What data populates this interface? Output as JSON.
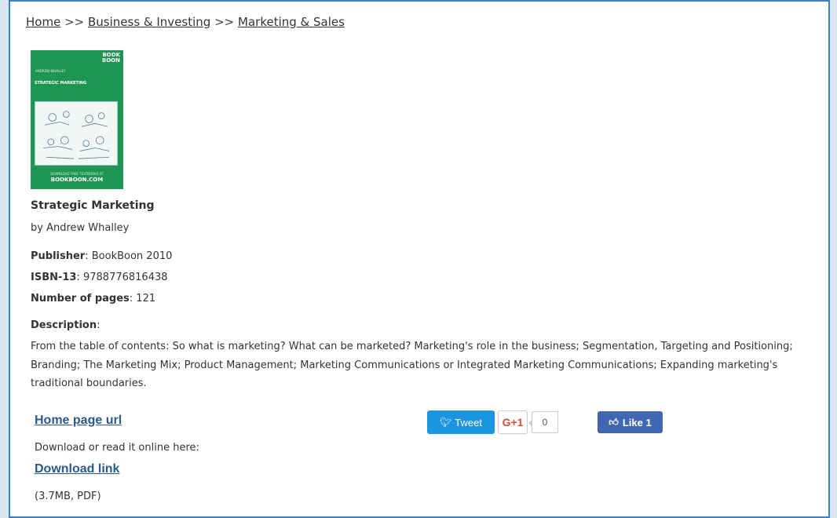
{
  "breadcrumb": {
    "items": [
      "Home",
      "Business & Investing",
      "Marketing & Sales"
    ],
    "separator": ">>"
  },
  "cover": {
    "logo": "BOOK BOON",
    "author_small": "ANDREW WHALLEY",
    "title_small": "STRATEGIC MARKETING",
    "footer_tag": "DOWNLOAD FREE TEXTBOOKS AT",
    "footer_brand": "BOOKBOON.COM",
    "background_color": "#1e9651"
  },
  "book": {
    "title": "Strategic Marketing",
    "author": "by Andrew Whalley",
    "publisher_label": "Publisher",
    "publisher_value": ": BookBoon 2010",
    "isbn_label": "ISBN-13",
    "isbn_value": ": 9788776816438",
    "pages_label": "Number of pages",
    "pages_value": ": 121",
    "description_label": "Description",
    "description_colon": ":",
    "description": "From the table of contents: So what is marketing? What can be marketed? Marketing's role in the business; Segmentation, Targeting and Positioning; Branding; The Marketing Mix; Product Management; Marketing Communications or Integrated Marketing Communications; Expanding marketing's traditional boundaries."
  },
  "links": {
    "home_page": "Home page url",
    "download_note": "Download or read it online here:",
    "download": "Download link",
    "file_info": "(3.7MB, PDF)"
  },
  "social": {
    "tweet_label": "Tweet",
    "gplus_label": "G+1",
    "gplus_count": "0",
    "like_label": "Like 1",
    "tweet_color": "#1b95e0",
    "facebook_color": "#4267b2",
    "gplus_color": "#dd4b39"
  },
  "icons": [
    "twitter-bird-icon",
    "facebook-thumbs-up-icon"
  ]
}
